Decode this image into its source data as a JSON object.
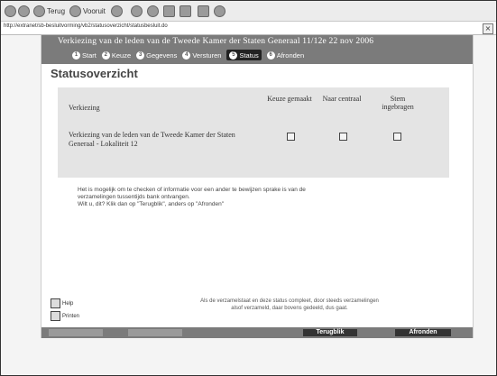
{
  "toolbar": {
    "back_label": "Terug",
    "forward_label": "Vooruit"
  },
  "address": {
    "url": "http://extranet/sb-besluitvorming/vb2/statusoverzicht/statusbesluit.do"
  },
  "header": {
    "title": "Verkiezing van de leden van de Tweede Kamer der Staten Generaal 11/12e 22 nov 2006",
    "steps": [
      {
        "num": "1",
        "label": "Start"
      },
      {
        "num": "2",
        "label": "Keuze"
      },
      {
        "num": "3",
        "label": "Gegevens"
      },
      {
        "num": "4",
        "label": "Versturen"
      },
      {
        "num": "5",
        "label": "Status"
      },
      {
        "num": "6",
        "label": "Afronden"
      }
    ]
  },
  "main": {
    "heading": "Statusoverzicht",
    "table": {
      "col_verkiezing": "Verkiezing",
      "col_keuze": "Keuze gemaakt",
      "col_naar": "Naar centraal",
      "col_stem": "Stem ingebragen",
      "rows": [
        {
          "label": "Verkiezing van de leden van de Tweede Kamer der Staten Generaal - Lokaliteit 12"
        }
      ]
    },
    "info_lines": [
      "Het is mogelijk om te checken of informatie voor een ander te bewijzen sprake is van de",
      "verzamelingen tussentijds bank ontvangen.",
      "Wilt u, dit? Klik dan op \"Terugblik\", anders op \"Afronden\""
    ],
    "footnote_lines": [
      "Als de verzamelstaat en deze status compleet, door steeds verzamelingen",
      "alsof verzameld, daar bovens gedeeld, dus gaat."
    ]
  },
  "side_links": {
    "help_label": "Help",
    "print_label": "Printen"
  },
  "bottom": {
    "terugblik_label": "Terugblik",
    "afronden_label": "Afronden"
  }
}
